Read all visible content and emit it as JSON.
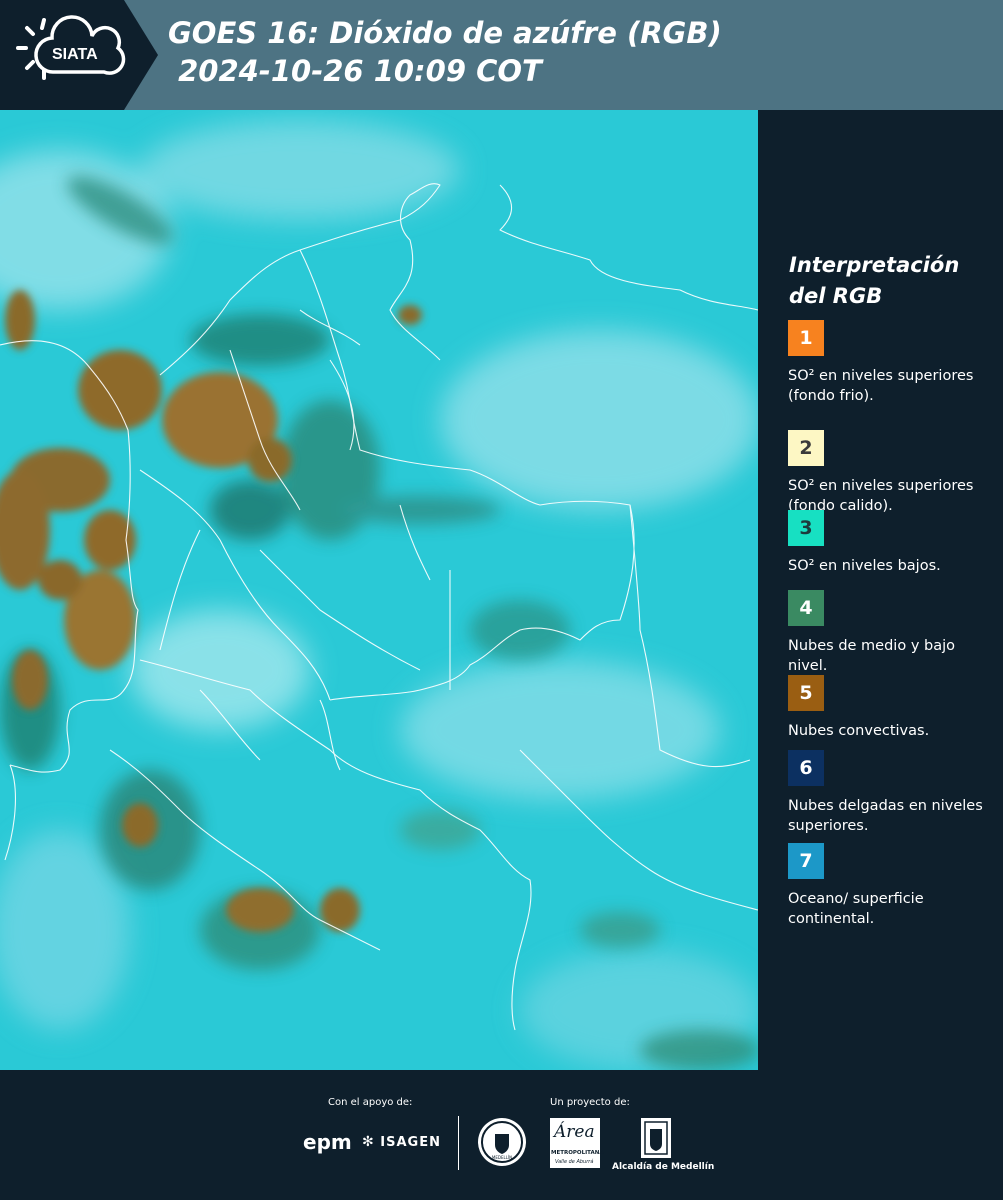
{
  "header": {
    "logo_text": "SIATA",
    "title_line1": "GOES 16: Dióxido de azúfre (RGB)",
    "title_line2": " 2024-10-26 10:09 COT"
  },
  "legend": {
    "title": "Interpretación del RGB",
    "items": [
      {
        "number": "1",
        "label": "SO² en niveles superiores (fondo frio).",
        "color": "#f7821f",
        "num_color": "#ffffff"
      },
      {
        "number": "2",
        "label": "SO² en niveles superiores (fondo calido).",
        "color": "#fdf7c4",
        "num_color": "#3a3a3a"
      },
      {
        "number": "3",
        "label": "SO² en niveles bajos.",
        "color": "#17e0c2",
        "num_color": "#1d3a3c"
      },
      {
        "number": "4",
        "label": "Nubes de medio y bajo nivel.",
        "color": "#3a8a62",
        "num_color": "#ffffff"
      },
      {
        "number": "5",
        "label": "Nubes convectivas.",
        "color": "#9a5e12",
        "num_color": "#ffffff"
      },
      {
        "number": "6",
        "label": "Nubes delgadas en niveles superiores.",
        "color": "#0c3061",
        "num_color": "#ffffff"
      },
      {
        "number": "7",
        "label": "Oceano/ superficie continental.",
        "color": "#1c98c8",
        "num_color": "#ffffff"
      }
    ]
  },
  "footer": {
    "support_label": "Con el apoyo de:",
    "project_label": "Un proyecto de:",
    "epm": "epm",
    "isagen": "ISAGEN",
    "area_name": "Área",
    "area_sub1": "METROPOLITANA",
    "area_sub2": "Valle de Aburrá",
    "alcaldia": "Alcaldía de Medellín",
    "medellin_seal": "MEDELLÍN"
  }
}
